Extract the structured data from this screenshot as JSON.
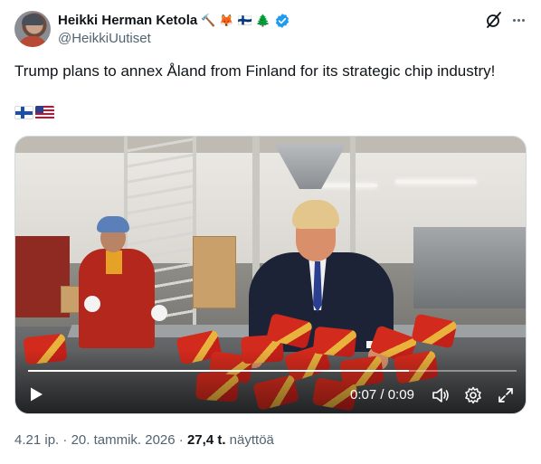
{
  "author": {
    "display_name": "Heikki Herman Ketola",
    "name_emojis": [
      "🔨",
      "🦊",
      "🇫🇮",
      "🌲"
    ],
    "handle": "@HeikkiUutiset",
    "verified": true
  },
  "tweet": {
    "text": "Trump plans to annex Åland from Finland for its strategic chip industry!",
    "flag_emojis": [
      "🇫🇮",
      "🇺🇸"
    ]
  },
  "video": {
    "current_time": "0:07",
    "separator": "/",
    "duration": "0:09",
    "progress_fraction": 0.78
  },
  "meta": {
    "time": "4.21 ip.",
    "dot1": "·",
    "date": "20. tammik. 2026",
    "dot2": "·",
    "views_count": "27,4 t.",
    "views_label": "näyttöä"
  },
  "colors": {
    "text_primary": "#0f1419",
    "text_secondary": "#536471",
    "verified_blue": "#1d9bf0",
    "border": "#cfd9de"
  },
  "icons": {
    "grok": "grok-icon",
    "more": "more-dots-icon",
    "play": "play-icon",
    "volume": "volume-icon",
    "settings": "settings-gear-icon",
    "fullscreen": "fullscreen-icon"
  }
}
